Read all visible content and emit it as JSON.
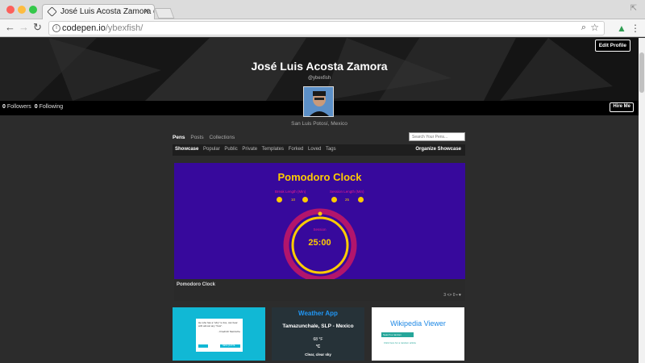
{
  "browser": {
    "tab_title": "José Luis Acosta Zamora on C",
    "tab_close": "×",
    "url_host": "codepen.io",
    "url_path": "/ybexfish/",
    "window_controls": "⇱"
  },
  "colors": {
    "pen_bg": "#37099c",
    "pen_accent": "#ffcc00",
    "pen_pink": "#e91e8c",
    "weather_bg": "#263238",
    "quote_bg": "#11b8d5"
  },
  "profile": {
    "edit_label": "Edit Profile",
    "name": "José Luis Acosta Zamora",
    "handle": "@ybexfish",
    "followers_count": "0",
    "followers_label": "Followers",
    "following_count": "0",
    "following_label": "Following",
    "hire_label": "Hire Me",
    "location": "San Luis Potosí, Mexico"
  },
  "tabs": [
    "Pens",
    "Posts",
    "Collections"
  ],
  "search_placeholder": "Search Your Pens...",
  "filters": [
    "Showcase",
    "Popular",
    "Public",
    "Private",
    "Templates",
    "Forked",
    "Loved",
    "Tags"
  ],
  "organize_label": "Organize Showcase",
  "showcase": {
    "title": "Pomodoro Clock",
    "break_label": "Break Length (Min)",
    "session_label": "Session Length (Min)",
    "break_value": "10",
    "session_value": "25",
    "minus": "-",
    "plus": "+",
    "timer_label": "Session",
    "timer_value": "25:00",
    "footer_name": "Pomodoro Clock",
    "views": "3",
    "comments": "0"
  },
  "cards": {
    "quote_text": "He who has a \"why\" to live, can bear with almost any \"how\".",
    "quote_author": "- Friedrich Nietzsche",
    "quote_button": "NEW QUOTE",
    "weather_title": "Weather App",
    "weather_location": "Tamazunchale, SLP - Mexico",
    "weather_temp": "68 °F",
    "weather_unit": "°C",
    "weather_desc": "Clear, clear sky",
    "wiki_title": "Wikipedia Viewer",
    "wiki_search": "Search a random",
    "wiki_click": "Click here for a random article"
  }
}
